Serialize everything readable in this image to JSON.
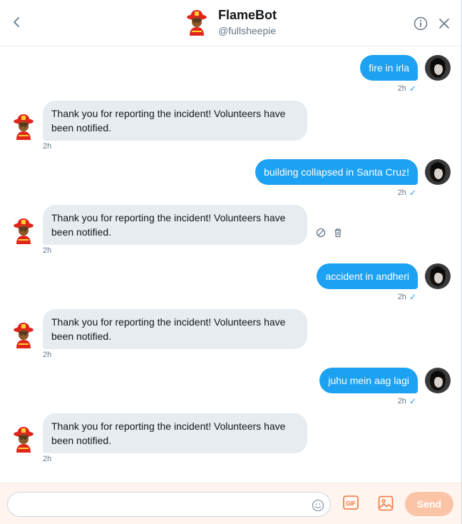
{
  "header": {
    "title": "FlameBot",
    "handle": "@fullsheepie",
    "back_icon": "chevron-left-icon",
    "info_icon": "info-icon",
    "close_icon": "close-icon"
  },
  "messages": [
    {
      "direction": "out",
      "text": "fire in irla",
      "time": "2h",
      "status": "✓"
    },
    {
      "direction": "in",
      "text": "Thank you for reporting the incident! Volunteers have been notified.",
      "time": "2h"
    },
    {
      "direction": "out",
      "text": "building collapsed in Santa Cruz!",
      "time": "2h",
      "status": "✓"
    },
    {
      "direction": "in",
      "text": "Thank you for reporting the incident! Volunteers have been notified.",
      "time": "2h"
    },
    {
      "direction": "out",
      "text": "accident in andheri",
      "time": "2h",
      "status": "✓"
    },
    {
      "direction": "in",
      "text": "Thank you for reporting the incident! Volunteers have been notified.",
      "time": "2h"
    },
    {
      "direction": "out",
      "text": "juhu mein aag lagi",
      "time": "2h",
      "status": "✓"
    },
    {
      "direction": "in",
      "text": "Thank you for reporting the incident! Volunteers have been notified.",
      "time": "2h"
    }
  ],
  "message_actions": {
    "block_icon": "block-icon",
    "delete_icon": "trash-icon"
  },
  "composer": {
    "placeholder": "",
    "value": "",
    "emoji_icon": "emoji-icon",
    "gif_label": "GIF",
    "media_icon": "image-icon",
    "send_label": "Send"
  },
  "colors": {
    "accent": "#1da1f2",
    "incoming_bubble": "#e6ecf0",
    "composer_bg": "#fff4ee",
    "brand_orange": "#f4743b",
    "send_disabled": "#fcc4a6"
  }
}
